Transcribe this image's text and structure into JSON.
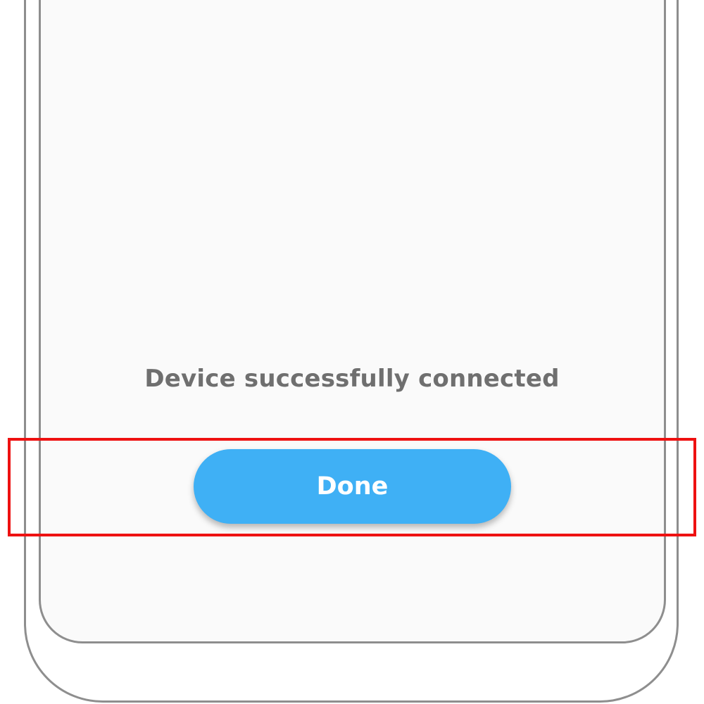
{
  "screen": {
    "status_message": "Device successfully connected",
    "done_button_label": "Done"
  },
  "colors": {
    "accent": "#3fb0f5",
    "frame_outline": "#8e8e8e",
    "screen_background": "#fafafa",
    "status_text": "#6f6f6f",
    "highlight": "#ee1111"
  }
}
